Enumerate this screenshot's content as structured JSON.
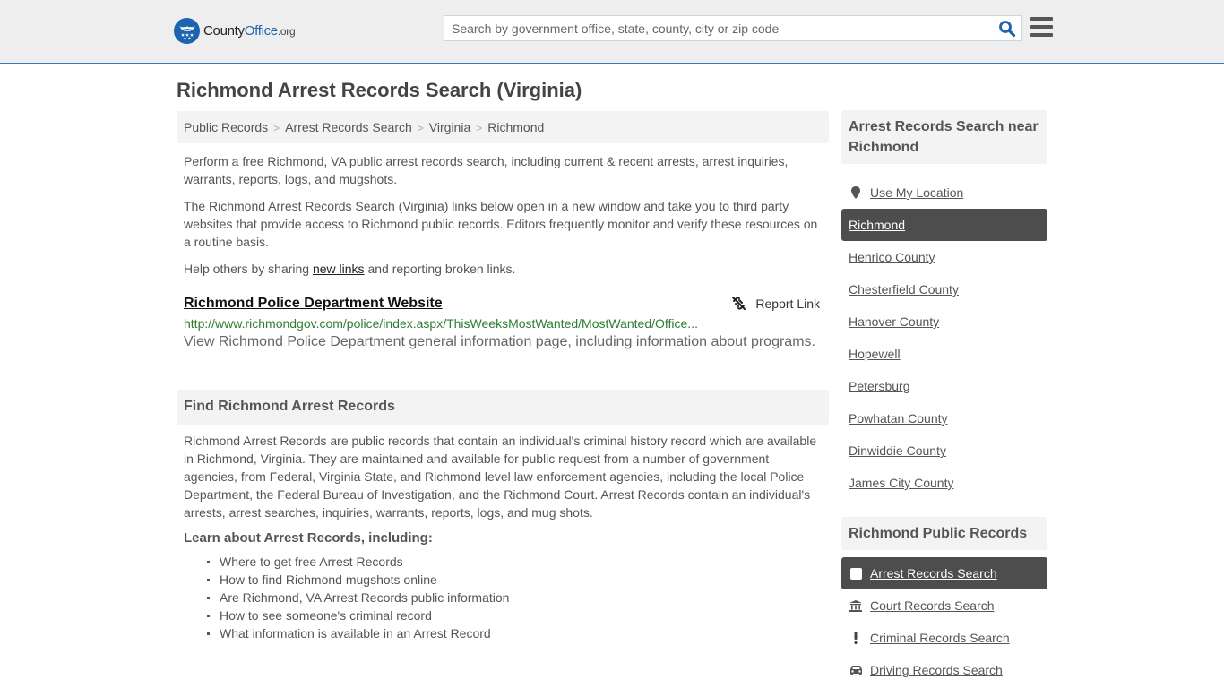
{
  "header": {
    "logo": {
      "part1": "County",
      "part2": "Office",
      "part3": ".org"
    },
    "search": {
      "placeholder": "Search by government office, state, county, city or zip code",
      "value": ""
    },
    "colors": {
      "brand": "#1e63ad",
      "accent_border": "#337ab7"
    }
  },
  "page": {
    "title": "Richmond Arrest Records Search (Virginia)",
    "breadcrumb": [
      "Public Records",
      "Arrest Records Search",
      "Virginia",
      "Richmond"
    ],
    "intro": "Perform a free Richmond, VA public arrest records search, including current & recent arrests, arrest inquiries, warrants, reports, logs, and mugshots.",
    "disclaimer": "The Richmond Arrest Records Search (Virginia) links below open in a new window and take you to third party websites that provide access to Richmond public records. Editors frequently monitor and verify these resources on a routine basis.",
    "help": {
      "before": "Help others by sharing ",
      "link": "new links",
      "after": " and reporting broken links."
    },
    "listing": {
      "title": "Richmond Police Department Website",
      "report_label": "Report Link",
      "url": "http://www.richmondgov.com/police/index.aspx/ThisWeeksMostWanted/MostWanted/Office...",
      "description": "View Richmond Police Department general information page, including information about programs."
    },
    "find_section": {
      "heading": "Find Richmond Arrest Records",
      "body": "Richmond Arrest Records are public records that contain an individual's criminal history record which are available in Richmond, Virginia. They are maintained and available for public request from a number of government agencies, from Federal, Virginia State, and Richmond level law enforcement agencies, including the local Police Department, the Federal Bureau of Investigation, and the Richmond Court. Arrest Records contain an individual's arrests, arrest searches, inquiries, warrants, reports, logs, and mug shots.",
      "learn_heading": "Learn about Arrest Records, including:",
      "learn_items": [
        "Where to get free Arrest Records",
        "How to find Richmond mugshots online",
        "Are Richmond, VA Arrest Records public information",
        "How to see someone's criminal record",
        "What information is available in an Arrest Record"
      ]
    }
  },
  "sidebar": {
    "nearby": {
      "heading": "Arrest Records Search near Richmond",
      "use_location": "Use My Location",
      "items": [
        "Richmond",
        "Henrico County",
        "Chesterfield County",
        "Hanover County",
        "Hopewell",
        "Petersburg",
        "Powhatan County",
        "Dinwiddie County",
        "James City County"
      ],
      "active": "Richmond"
    },
    "public_records": {
      "heading": "Richmond Public Records",
      "items": [
        {
          "label": "Arrest Records Search",
          "icon": "square-icon",
          "active": true
        },
        {
          "label": "Court Records Search",
          "icon": "courthouse-icon",
          "active": false
        },
        {
          "label": "Criminal Records Search",
          "icon": "exclamation-icon",
          "active": false
        },
        {
          "label": "Driving Records Search",
          "icon": "car-icon",
          "active": false
        }
      ]
    }
  }
}
